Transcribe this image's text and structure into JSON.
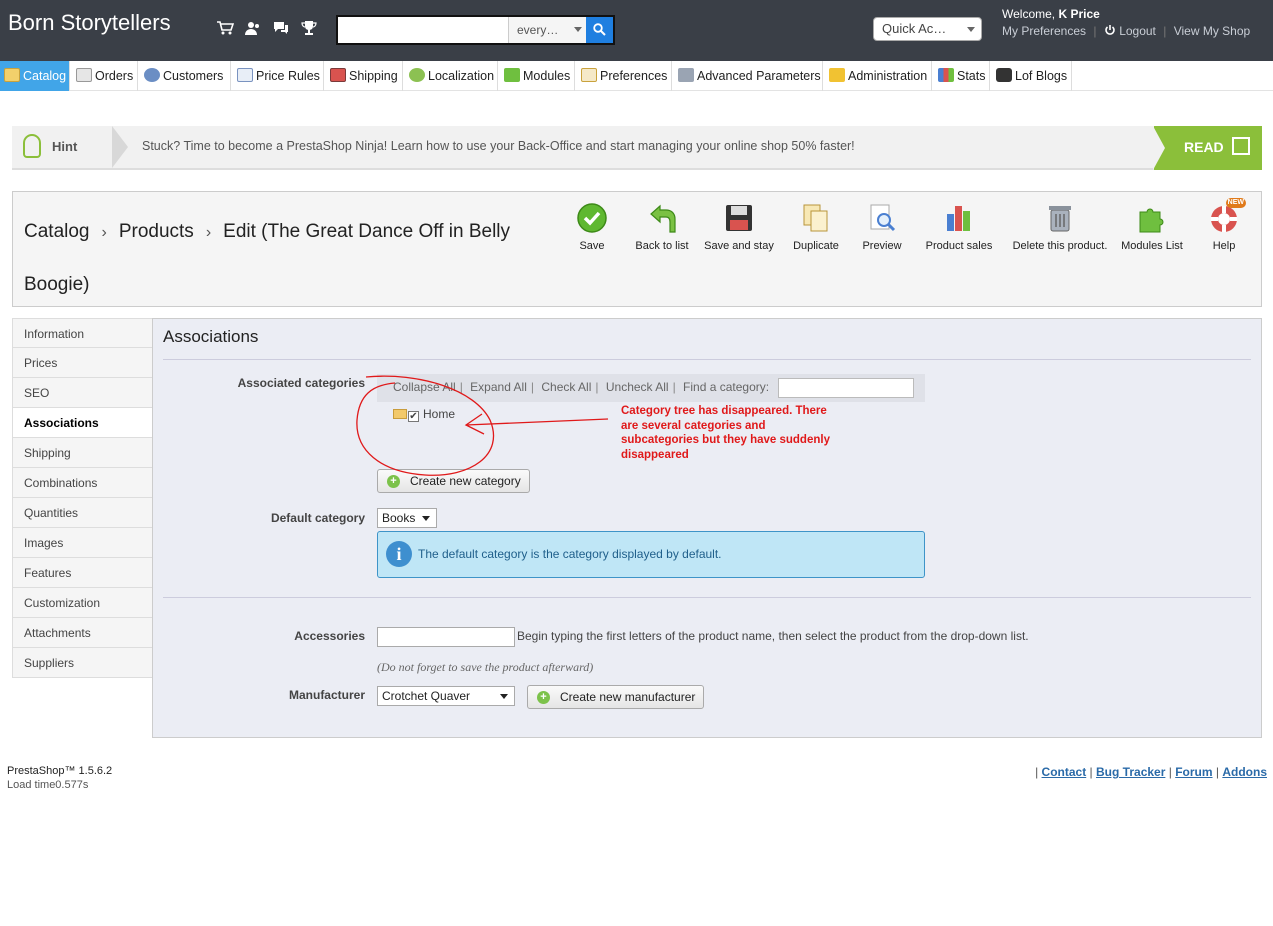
{
  "header": {
    "shop_name": "Born Storytellers",
    "icons": [
      "cart-icon",
      "customers-icon",
      "messages-icon",
      "trophy-icon"
    ],
    "search_placeholder": "",
    "search_scope": "every…",
    "quick_access": "Quick Ac…",
    "welcome_prefix": "Welcome,",
    "user_name": "K Price",
    "my_preferences": "My Preferences",
    "logout": "Logout",
    "view_shop": "View My Shop"
  },
  "menu": {
    "items": [
      {
        "label": "Catalog",
        "icon": "folder-icon",
        "active": true
      },
      {
        "label": "Orders",
        "icon": "cart-icon"
      },
      {
        "label": "Customers",
        "icon": "customer-icon"
      },
      {
        "label": "Price Rules",
        "icon": "price-rules-icon"
      },
      {
        "label": "Shipping",
        "icon": "truck-icon"
      },
      {
        "label": "Localization",
        "icon": "globe-icon"
      },
      {
        "label": "Modules",
        "icon": "puzzle-icon"
      },
      {
        "label": "Preferences",
        "icon": "preferences-icon"
      },
      {
        "label": "Advanced Parameters",
        "icon": "wrench-icon"
      },
      {
        "label": "Administration",
        "icon": "key-icon"
      },
      {
        "label": "Stats",
        "icon": "bar-chart-icon"
      },
      {
        "label": "Lof Blogs",
        "icon": "lock-icon"
      }
    ]
  },
  "hint": {
    "label": "Hint",
    "text": "Stuck? Time to become a PrestaShop Ninja! Learn how to use your Back-Office and start managing your online shop 50% faster!",
    "read": "READ"
  },
  "breadcrumb": {
    "parts": [
      "Catalog",
      "Products",
      "Edit (The Great Dance Off in Belly Boogie)"
    ]
  },
  "toolbar": {
    "buttons": [
      {
        "label": "Save",
        "icon": "save-check-icon"
      },
      {
        "label": "Back to list",
        "icon": "back-arrow-icon"
      },
      {
        "label": "Save and stay",
        "icon": "floppy-icon"
      },
      {
        "label": "Duplicate",
        "icon": "duplicate-icon"
      },
      {
        "label": "Preview",
        "icon": "preview-icon"
      },
      {
        "label": "Product sales",
        "icon": "sales-chart-icon"
      },
      {
        "label": "Delete this product.",
        "icon": "trash-icon"
      },
      {
        "label": "Modules List",
        "icon": "puzzle-icon"
      },
      {
        "label": "Help",
        "icon": "lifebuoy-icon",
        "badge": "NEW"
      }
    ]
  },
  "tabs": [
    "Information",
    "Prices",
    "SEO",
    "Associations",
    "Shipping",
    "Combinations",
    "Quantities",
    "Images",
    "Features",
    "Customization",
    "Attachments",
    "Suppliers"
  ],
  "active_tab": "Associations",
  "panel": {
    "title": "Associations",
    "associated_categories_label": "Associated categories",
    "tree_tools": {
      "collapse": "Collapse All",
      "expand": "Expand All",
      "check": "Check All",
      "uncheck": "Uncheck All",
      "find": "Find a category:"
    },
    "tree_home": "Home",
    "create_category": "Create new category",
    "default_category_label": "Default category",
    "default_category_value": "Books",
    "info_text": "The default category is the category displayed by default.",
    "accessories_label": "Accessories",
    "accessories_help": "Begin typing the first letters of the product name, then select the product from the drop-down list.",
    "accessories_note": "(Do not forget to save the product afterward)",
    "manufacturer_label": "Manufacturer",
    "manufacturer_value": "Crotchet Quaver",
    "create_manufacturer": "Create new manufacturer"
  },
  "annotation": {
    "text": "Category tree has disappeared. There are several categories and subcategories but they have suddenly disappeared",
    "color": "#e0191a"
  },
  "footer": {
    "version": "PrestaShop™ 1.5.6.2",
    "load_time": "Load time0.577s",
    "links": [
      "Contact",
      "Bug Tracker",
      "Forum",
      "Addons"
    ]
  }
}
